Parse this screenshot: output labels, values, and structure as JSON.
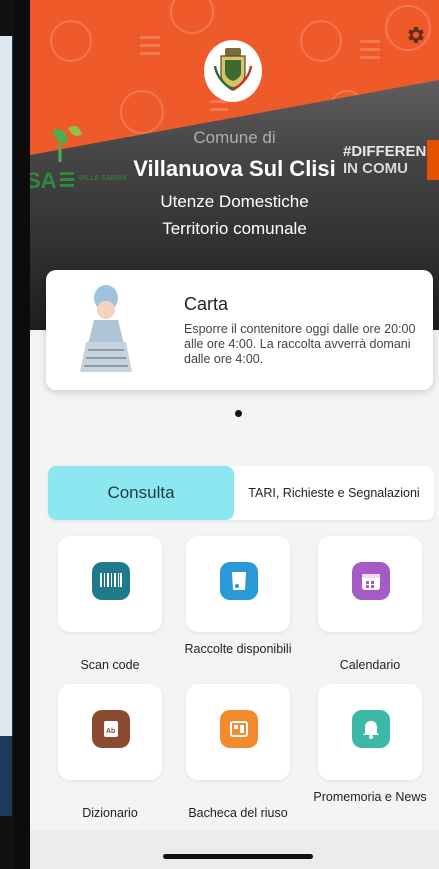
{
  "header": {
    "comune_label": "Comune di",
    "town": "Villanuova Sul Clisi",
    "user_type": "Utenze Domestiche",
    "territory": "Territorio comunale",
    "logo_left_text": "SA",
    "logo_left_sub": "VALLE SABBIA",
    "logo_right_text_1": "#DIFFEREN",
    "logo_right_text_2": "IN COMU",
    "settings_icon": "gear-icon"
  },
  "card": {
    "title": "Carta",
    "text": "Esporre il contenitore oggi dalle ore 20:00 alle ore 4:00. La raccolta avverrà domani dalle ore 4:00."
  },
  "tabs": {
    "active": "Consulta",
    "other": "TARI, Richieste e Segnalazioni"
  },
  "grid": [
    {
      "label": "Scan code",
      "icon": "barcode-icon",
      "color": "#1f7a8c"
    },
    {
      "label": "Raccolte disponibili",
      "icon": "bin-icon",
      "color": "#2a9ad6"
    },
    {
      "label": "Calendario",
      "icon": "calendar-icon",
      "color": "#a45bc4"
    },
    {
      "label": "Dizionario",
      "icon": "dictionary-icon",
      "color": "#8a4b30"
    },
    {
      "label": "Bacheca del riuso",
      "icon": "board-icon",
      "color": "#f28a2e"
    },
    {
      "label": "Promemoria e News",
      "icon": "bell-icon",
      "color": "#3bb8a6"
    }
  ],
  "colors": {
    "header_orange": "#ef5a2a",
    "tab_active": "#8de7f1"
  }
}
